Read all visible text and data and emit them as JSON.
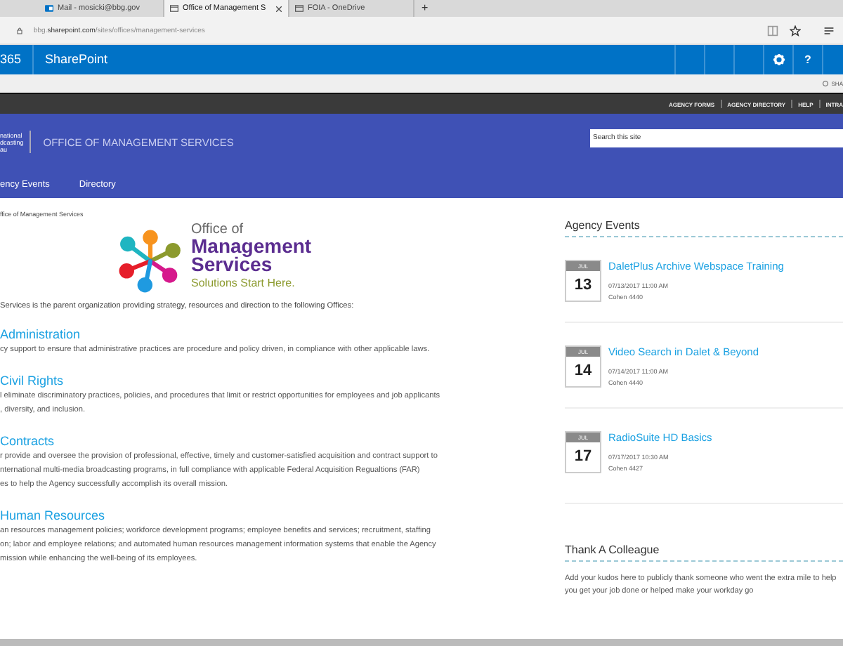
{
  "browser": {
    "tabs": [
      {
        "label": "Mail - mosicki@bbg.gov",
        "kind": "mail",
        "selected": false
      },
      {
        "label": "Office of Management S",
        "kind": "page",
        "selected": true
      },
      {
        "label": "FOIA - OneDrive",
        "kind": "page",
        "selected": false
      }
    ],
    "new_tab": "+",
    "address": {
      "host_prefix": "bbg.",
      "host": "sharepoint.com",
      "path": "/sites/offices/management-services"
    }
  },
  "suite_bar": {
    "app_launcher": "365",
    "title": "SharePoint",
    "help": "?"
  },
  "share_label": "SHA",
  "top_links": [
    "AGENCY FORMS",
    "AGENCY DIRECTORY",
    "HELP",
    "INTRA"
  ],
  "site_header": {
    "logo_lines": [
      "national",
      "dcasting",
      "au"
    ],
    "title": "OFFICE OF MANAGEMENT SERVICES",
    "search": {
      "placeholder": "Search this site"
    }
  },
  "nav": [
    "ency Events",
    "Directory"
  ],
  "breadcrumb": "ffice of Management Services",
  "logo": {
    "line_1": "Office of",
    "line_2": "Management",
    "line_3": "Services",
    "tagline": "Solutions Start Here."
  },
  "intro": "Services is the parent organization providing strategy, resources and direction to the following Offices:",
  "sections": [
    {
      "title": "Administration",
      "lines": [
        "cy support to ensure that administrative practices are procedure and policy driven, in compliance with other applicable laws."
      ]
    },
    {
      "title": "Civil Rights",
      "lines": [
        "l eliminate discriminatory practices, policies, and procedures that limit or restrict opportunities for employees and job applicants",
        ", diversity, and inclusion."
      ]
    },
    {
      "title": "Contracts",
      "lines": [
        "r provide and oversee the provision of professional, effective, timely and customer-satisfied acquisition and contract support to",
        "nternational multi-media broadcasting programs, in full compliance with applicable Federal Acquisition Regualtions (FAR)",
        "es to help the Agency successfully accomplish its overall mission."
      ]
    },
    {
      "title": "Human Resources",
      "lines": [
        "an resources management policies; workforce development programs; employee benefits and services; recruitment, staffing",
        "on; labor and employee relations; and automated human resources management information systems that enable the Agency",
        "mission while enhancing the well-being of its employees."
      ]
    }
  ],
  "agency_events": {
    "title": "Agency Events",
    "events": [
      {
        "month": "JUL",
        "day": "13",
        "title": "DaletPlus Archive Webspace Training",
        "when": "07/13/2017 11:00 AM",
        "where": "Cohen 4440"
      },
      {
        "month": "JUL",
        "day": "14",
        "title": "Video Search in Dalet & Beyond",
        "when": "07/14/2017 11:00 AM",
        "where": "Cohen 4440"
      },
      {
        "month": "JUL",
        "day": "17",
        "title": "RadioSuite HD Basics",
        "when": "07/17/2017 10:30 AM",
        "where": "Cohen 4427"
      }
    ]
  },
  "thank_colleague": {
    "title": "Thank A Colleague",
    "text": "Add your kudos here to publicly thank someone who went the extra mile to help you get your job done or helped make your workday go"
  }
}
